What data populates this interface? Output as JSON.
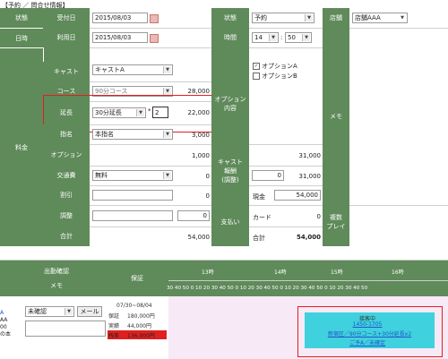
{
  "breadcrumb": "【予約 ／ 問合せ情報】",
  "form": {
    "status_label": "状態",
    "date_label": "日時",
    "kin_label": "料金",
    "receipt_label": "受付日",
    "receipt_value": "2015/08/03",
    "use_label": "利用日",
    "use_value": "2015/08/03",
    "cast_label": "キャスト",
    "cast_value": "キャストA",
    "course_label": "コース",
    "course_value": "90分コース",
    "course_price": "28,000",
    "ext_label": "延長",
    "ext_value": "30分延長",
    "ext_mult": "*",
    "ext_qty": "2",
    "ext_price": "22,000",
    "nomi_label": "指名",
    "nomi_value": "本指名",
    "nomi_price": "3,000",
    "option_label": "オプション",
    "option_price": "1,000",
    "transport_label": "交通費",
    "transport_value": "無料",
    "transport_price": "0",
    "discount_label": "割引",
    "discount_price": "0",
    "adjust_label": "調整",
    "adjust_input": "0",
    "adjust_price": "0",
    "total_label": "合計",
    "total_price": "54,000",
    "state_label": "状態",
    "state_value": "予約",
    "time_label": "時間",
    "time_hour": "14",
    "time_sep": ":",
    "time_min": "50",
    "option_content_label": "オプション\n内容",
    "optA": "オプションA",
    "optB": "オプションB",
    "cast_reward_label": "キャスト\n報酬\n(調整)",
    "cast_reward_value": "31,000",
    "reward_input": "0",
    "reward_total": "31,000",
    "payment_label": "支払い",
    "cash_label": "現金",
    "cash_value": "54,000",
    "card_label": "カード",
    "card_value": "0",
    "pay_total_label": "合計",
    "pay_total_value": "54,000",
    "store_label": "店舗",
    "store_value": "店舗AAA",
    "memo_label": "メモ",
    "play_label": "複数\nプレイ"
  },
  "schedule": {
    "col_attend": "出勤確認",
    "col_memo": "メモ",
    "col_guarantee": "保証",
    "row_prefix": [
      "A",
      "AA",
      "00",
      "の本"
    ],
    "attend_value": "未確認",
    "mail_button": "メール",
    "date_range": "07/30~08/04",
    "g_guarantee_label": "保証",
    "g_guarantee_value": "180,000円",
    "g_actual_label": "実績",
    "g_actual_value": "44,000円",
    "g_short_label": "残差",
    "g_short_value": "136,000円",
    "hours": [
      "13時",
      "14時",
      "15時",
      "16時"
    ],
    "ticks": "30 40 50 0 10 20 30 40 50 0 10 20 30 40 50 0 10 20 30 40 50 0 10 20 30 40 50",
    "booking_line1": "接客中",
    "booking_line2": "1450-1705",
    "booking_line3": "新宿区／90分コース+30分延長x2",
    "booking_line4": "ご予A／未確定"
  },
  "colors": {
    "header_green": "#5f8a5a",
    "booking": "#3fd1dd",
    "red": "#e02020"
  }
}
